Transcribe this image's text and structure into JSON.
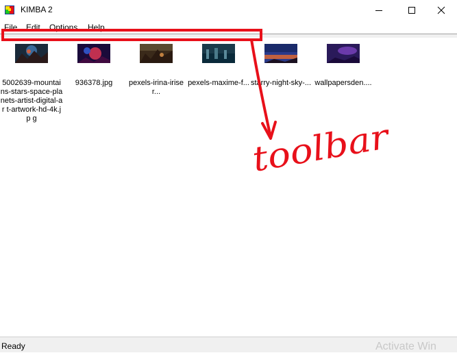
{
  "window": {
    "title": "KIMBA 2"
  },
  "menu": [
    {
      "label": "File"
    },
    {
      "label": "Edit"
    },
    {
      "label": "Options"
    },
    {
      "label": "Help"
    }
  ],
  "files": [
    {
      "name": "5002639-mountains-stars-space-planets-artist-digital-art-artwork-hd-4k.jpg",
      "display": "5002639-mountai ns-stars-space-pla nets-artist-digital-ar t-artwork-hd-4k.jp g"
    },
    {
      "name": "936378.jpg",
      "display": "936378.jpg"
    },
    {
      "name": "pexels-irina-iriser",
      "display": "pexels-irina-iriser..."
    },
    {
      "name": "pexels-maxime-f",
      "display": "pexels-maxime-f..."
    },
    {
      "name": "starry-night-sky",
      "display": "starry-night-sky-..."
    },
    {
      "name": "wallpapersden",
      "display": "wallpapersden...."
    }
  ],
  "status": {
    "text": "Ready"
  },
  "watermark": "Activate Win",
  "annotation": {
    "text": "toolbar",
    "color": "#e8101a"
  },
  "colors": {
    "annotation": "#e8101a"
  }
}
